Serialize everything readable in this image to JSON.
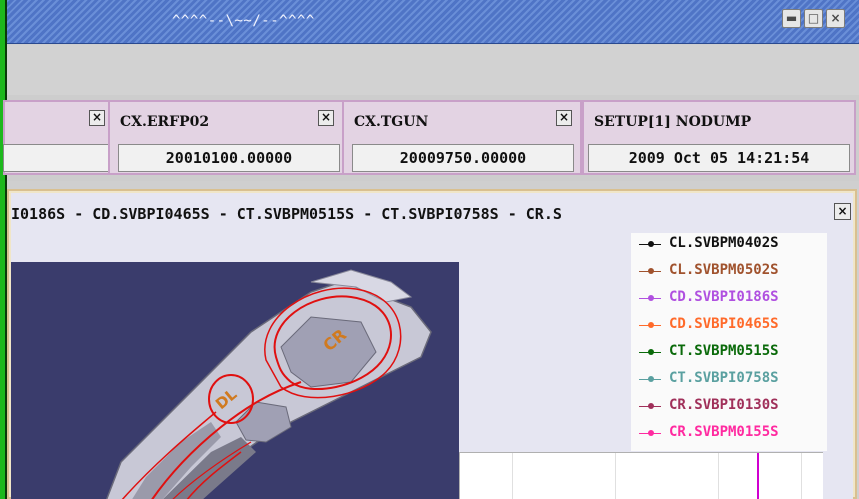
{
  "window": {
    "title": "^^^^--\\~~/--^^^^",
    "buttons": {
      "minimize": "▬",
      "maximize": "□",
      "close": "×"
    }
  },
  "panels": [
    {
      "label": "",
      "value": ""
    },
    {
      "label": "CX.ERFP02",
      "value": "20010100.00000"
    },
    {
      "label": "CX.TGUN",
      "value": "20009750.00000"
    },
    {
      "label": "SETUP[1] NODUMP",
      "value": "2009 Oct 05 14:21:54"
    }
  ],
  "close_glyph": "×",
  "plot": {
    "title": "I0186S  -  CD.SVBPI0465S  -  CT.SVBPM0515S  -  CT.SVBPI0758S  -  CR.S",
    "legend": [
      {
        "name": "CL.SVBPM0402S",
        "color": "#111111"
      },
      {
        "name": "CL.SVBPM0502S",
        "color": "#a0522d"
      },
      {
        "name": "CD.SVBPI0186S",
        "color": "#b050e0"
      },
      {
        "name": "CD.SVBPI0465S",
        "color": "#ff6a2a"
      },
      {
        "name": "CT.SVBPM0515S",
        "color": "#0a6a0a"
      },
      {
        "name": "CT.SVBPI0758S",
        "color": "#5aa0a0"
      },
      {
        "name": "CR.SVBPI0130S",
        "color": "#a0305a"
      },
      {
        "name": "CR.SVBPM0155S",
        "color": "#ff2aa0"
      }
    ],
    "map_labels": {
      "ring": "CR",
      "dl": "DL"
    },
    "colors": {
      "ring_line": "#e01010",
      "map_label": "#d07a20",
      "background": "#3a3c6c"
    }
  }
}
